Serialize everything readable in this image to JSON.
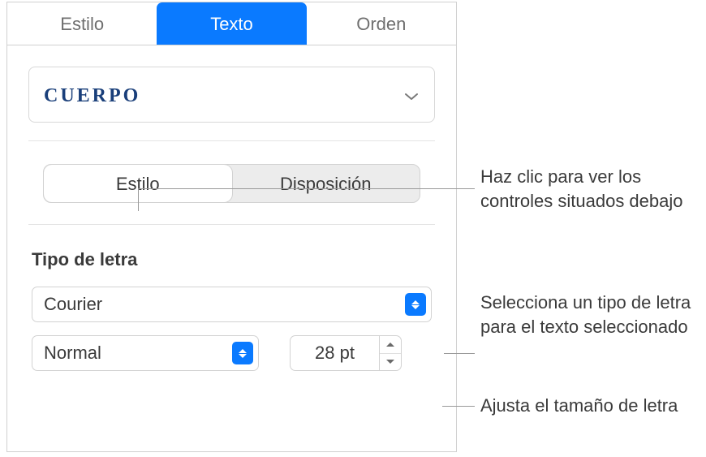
{
  "tabs": {
    "style": "Estilo",
    "text": "Texto",
    "order": "Orden",
    "active": "text"
  },
  "paragraph_style": {
    "label": "CUERPO"
  },
  "subtabs": {
    "style": "Estilo",
    "layout": "Disposición",
    "selected": "style"
  },
  "font": {
    "section_label": "Tipo de letra",
    "family": "Courier",
    "weight": "Normal",
    "size": "28 pt"
  },
  "callouts": {
    "subtabs": "Haz clic para ver los controles situados debajo",
    "font_family": "Selecciona un tipo de letra para el texto seleccionado",
    "font_size": "Ajusta el tamaño de letra"
  }
}
